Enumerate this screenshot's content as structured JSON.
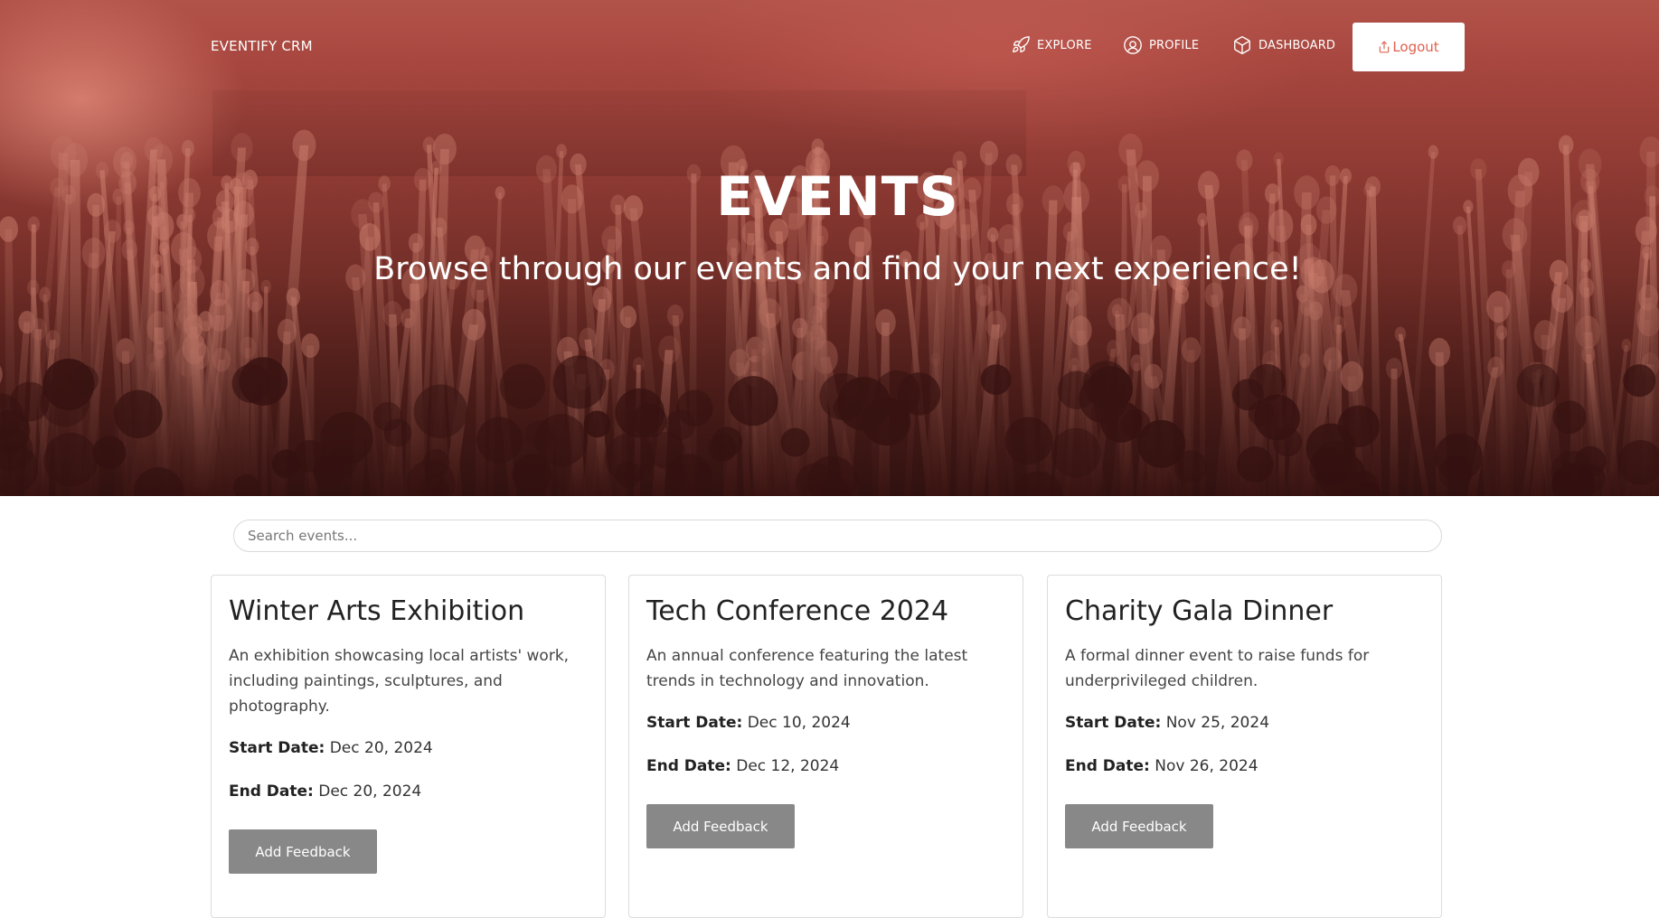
{
  "navbar": {
    "brand": "EVENTIFY CRM",
    "items": [
      {
        "label": "EXPLORE",
        "icon": "rocket-icon"
      },
      {
        "label": "PROFILE",
        "icon": "at-sign-icon"
      },
      {
        "label": "DASHBOARD",
        "icon": "box-icon"
      }
    ],
    "logout": {
      "label": "Logout",
      "icon": "logout-icon"
    }
  },
  "hero": {
    "title": "EVENTS",
    "subtitle": "Browse through our events and find your next experience!"
  },
  "search": {
    "placeholder": "Search events..."
  },
  "labels": {
    "start_date": "Start Date:",
    "end_date": "End Date:"
  },
  "events": [
    {
      "title": "Winter Arts Exhibition",
      "description": "An exhibition showcasing local artists' work, including paintings, sculptures, and photography.",
      "start_date": "Dec 20, 2024",
      "end_date": "Dec 20, 2024",
      "button": "Add Feedback"
    },
    {
      "title": "Tech Conference 2024",
      "description": "An annual conference featuring the latest trends in technology and innovation.",
      "start_date": "Dec 10, 2024",
      "end_date": "Dec 12, 2024",
      "button": "Add Feedback"
    },
    {
      "title": "Charity Gala Dinner",
      "description": "A formal dinner event to raise funds for underprivileged children.",
      "start_date": "Nov 25, 2024",
      "end_date": "Nov 26, 2024",
      "button": "Add Feedback"
    }
  ],
  "colors": {
    "hero_overlay": "#a8473f",
    "logout_text": "#e0604f",
    "button_gray": "#888888"
  }
}
